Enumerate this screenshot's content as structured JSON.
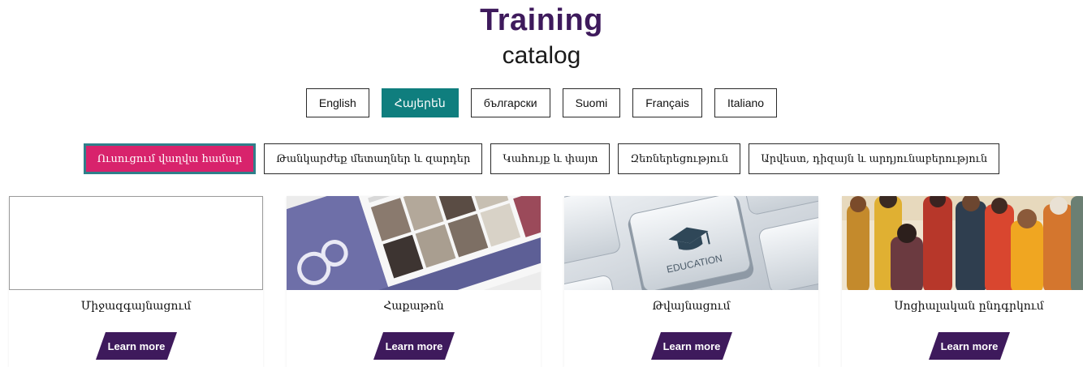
{
  "header": {
    "title": "Training",
    "subtitle": "catalog"
  },
  "languages": [
    {
      "label": "English",
      "active": false
    },
    {
      "label": "Հայերեն",
      "active": true
    },
    {
      "label": "български",
      "active": false
    },
    {
      "label": "Suomi",
      "active": false
    },
    {
      "label": "Français",
      "active": false
    },
    {
      "label": "Italiano",
      "active": false
    }
  ],
  "categories": [
    {
      "label": "Ուսուցում վաղվա համար",
      "active": true
    },
    {
      "label": "Թանկարժեք մետաղներ և զարդեր",
      "active": false
    },
    {
      "label": "Կահույք և փայտ",
      "active": false
    },
    {
      "label": "Զեռներեցություն",
      "active": false
    },
    {
      "label": "Արվեստ, դիզայն և արդյունաբերություն",
      "active": false
    }
  ],
  "cards": [
    {
      "title": "Միջազգայնացում",
      "image": "blank-placeholder",
      "button": "Learn more"
    },
    {
      "title": "Հաքաթոն",
      "image": "hackathon-fashion-collage",
      "button": "Learn more"
    },
    {
      "title": "Թվայնացում",
      "image": "education-keyboard-key",
      "button": "Learn more",
      "image_text": "EDUCATION"
    },
    {
      "title": "Սոցիալական ընդգրկում",
      "image": "people-crowd-illustration",
      "button": "Learn more"
    }
  ],
  "colors": {
    "brand_purple": "#3e1a5c",
    "lang_active_teal": "#0f7e7e",
    "category_active_pink": "#d8236c",
    "category_active_border": "#2f7f8a"
  }
}
